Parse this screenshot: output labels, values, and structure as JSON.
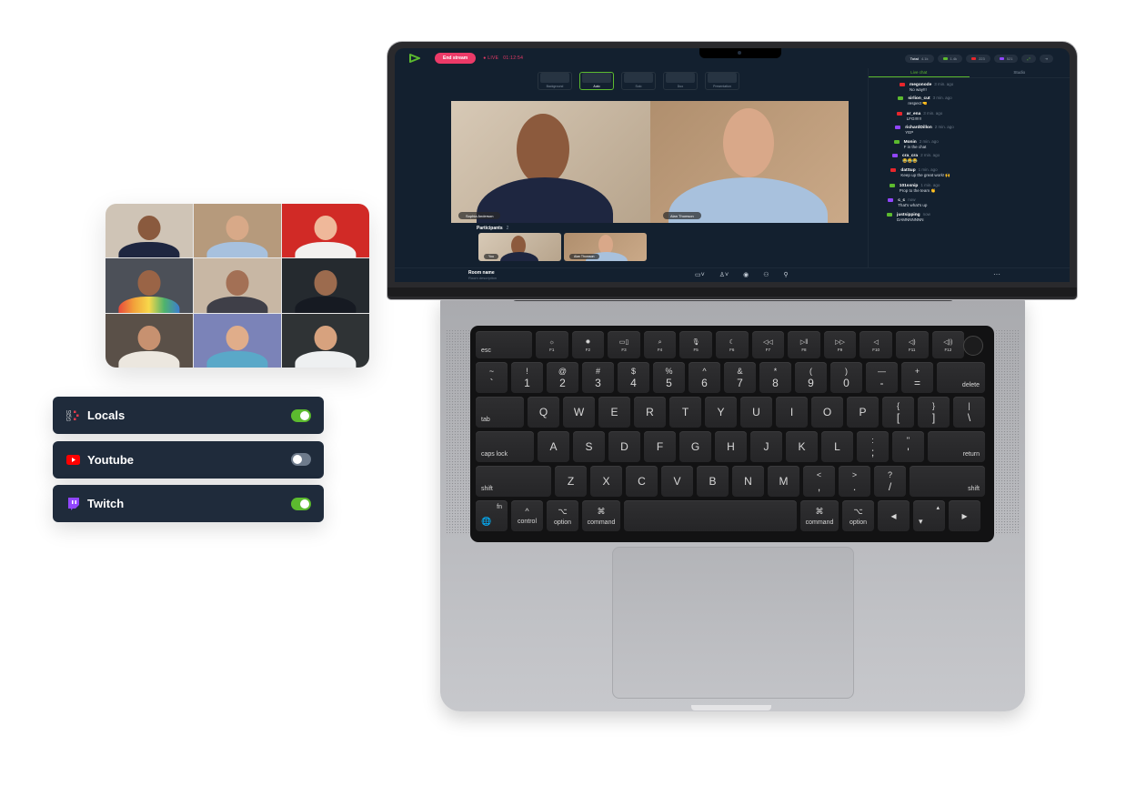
{
  "colors": {
    "accent_green": "#5cba2f",
    "live_red": "#ec3a68",
    "panel_dark": "#1f2b3b",
    "screen_bg": "#13202f",
    "youtube": "#ff0000",
    "twitch": "#9146ff",
    "locals": "#e33b4c"
  },
  "platforms": [
    {
      "name": "Locals",
      "icon": "locals-icon",
      "enabled": true
    },
    {
      "name": "Youtube",
      "icon": "youtube-icon",
      "enabled": false
    },
    {
      "name": "Twitch",
      "icon": "twitch-icon",
      "enabled": true
    }
  ],
  "app": {
    "end_stream_label": "End stream",
    "live_label": "● LIVE",
    "timer": "01:12:54",
    "stats": [
      {
        "label": "Total",
        "value": "4.1k",
        "icon": "total"
      },
      {
        "label": "",
        "value": "1.4k",
        "icon": "locals"
      },
      {
        "label": "",
        "value": "223",
        "icon": "youtube"
      },
      {
        "label": "",
        "value": "521",
        "icon": "twitch"
      }
    ],
    "layouts": [
      {
        "label": "Background",
        "active": false
      },
      {
        "label": "Auto",
        "active": true
      },
      {
        "label": "Solo",
        "active": false
      },
      {
        "label": "Duo",
        "active": false
      },
      {
        "label": "Presentation",
        "active": false
      }
    ],
    "stage": [
      {
        "name": "Sophia Anderson"
      },
      {
        "name": "Alan Thomson"
      }
    ],
    "participants_label": "Participants",
    "participants_count": "2",
    "participant_thumbs": [
      {
        "name": "You"
      },
      {
        "name": "Alan Thomson"
      }
    ],
    "room_name": "Room name",
    "room_description": "Room description",
    "tabs": [
      {
        "label": "Live chat",
        "active": true
      },
      {
        "label": "Studio",
        "active": false
      }
    ],
    "chat": [
      {
        "user": "megonode",
        "time": "3 min. ago",
        "text": "No way!!!",
        "platform": "youtube"
      },
      {
        "user": "sirlion_cut",
        "time": "3 min. ago",
        "text": "respect 🤜",
        "platform": "locals"
      },
      {
        "user": "ar_ena",
        "time": "3 min. ago",
        "text": "LFG!!!!!!",
        "platform": "youtube"
      },
      {
        "user": "richardDillon",
        "time": "2 min. ago",
        "text": "YEP",
        "platform": "twitch"
      },
      {
        "user": "Monin",
        "time": "2 min. ago",
        "text": "F in the chat",
        "platform": "locals"
      },
      {
        "user": "cra_cra",
        "time": "2 min. ago",
        "text": "😂😂😂",
        "platform": "twitch"
      },
      {
        "user": "datSup",
        "time": "1 min. ago",
        "text": "Keep up the great work! 🙌",
        "platform": "youtube"
      },
      {
        "user": "101ssnip",
        "time": "1 min. ago",
        "text": "Prop to the team 👏",
        "platform": "locals"
      },
      {
        "user": "c_c",
        "time": "now",
        "text": "That's what's up",
        "platform": "twitch"
      },
      {
        "user": "justsipping",
        "time": "now",
        "text": "DAMNNNNNN",
        "platform": "locals"
      }
    ]
  },
  "keyboard": {
    "row0": [
      {
        "b": "esc"
      },
      {
        "t": "☼",
        "b": "F1"
      },
      {
        "t": "✹",
        "b": "F2"
      },
      {
        "t": "▭▯",
        "b": "F3"
      },
      {
        "t": "⌕",
        "b": "F4"
      },
      {
        "t": "🎙",
        "b": "F5"
      },
      {
        "t": "☾",
        "b": "F6"
      },
      {
        "t": "◁◁",
        "b": "F7"
      },
      {
        "t": "▷‖",
        "b": "F8"
      },
      {
        "t": "▷▷",
        "b": "F9"
      },
      {
        "t": "◁",
        "b": "F10"
      },
      {
        "t": "◁)",
        "b": "F11"
      },
      {
        "t": "◁))",
        "b": "F12"
      }
    ],
    "row1": [
      {
        "t": "~",
        "b": "`"
      },
      {
        "t": "!",
        "b": "1"
      },
      {
        "t": "@",
        "b": "2"
      },
      {
        "t": "#",
        "b": "3"
      },
      {
        "t": "$",
        "b": "4"
      },
      {
        "t": "%",
        "b": "5"
      },
      {
        "t": "^",
        "b": "6"
      },
      {
        "t": "&",
        "b": "7"
      },
      {
        "t": "*",
        "b": "8"
      },
      {
        "t": "(",
        "b": "9"
      },
      {
        "t": ")",
        "b": "0"
      },
      {
        "t": "—",
        "b": "-"
      },
      {
        "t": "+",
        "b": "="
      },
      {
        "b": "delete"
      }
    ],
    "row2": [
      {
        "b": "tab"
      },
      {
        "b": "Q"
      },
      {
        "b": "W"
      },
      {
        "b": "E"
      },
      {
        "b": "R"
      },
      {
        "b": "T"
      },
      {
        "b": "Y"
      },
      {
        "b": "U"
      },
      {
        "b": "I"
      },
      {
        "b": "O"
      },
      {
        "b": "P"
      },
      {
        "t": "{",
        "b": "["
      },
      {
        "t": "}",
        "b": "]"
      },
      {
        "t": "|",
        "b": "\\"
      }
    ],
    "row3": [
      {
        "b": "caps lock"
      },
      {
        "b": "A"
      },
      {
        "b": "S"
      },
      {
        "b": "D"
      },
      {
        "b": "F"
      },
      {
        "b": "G"
      },
      {
        "b": "H"
      },
      {
        "b": "J"
      },
      {
        "b": "K"
      },
      {
        "b": "L"
      },
      {
        "t": ":",
        "b": ";"
      },
      {
        "t": "\"",
        "b": "'"
      },
      {
        "b": "return"
      }
    ],
    "row4": [
      {
        "b": "shift"
      },
      {
        "b": "Z"
      },
      {
        "b": "X"
      },
      {
        "b": "C"
      },
      {
        "b": "V"
      },
      {
        "b": "B"
      },
      {
        "b": "N"
      },
      {
        "b": "M"
      },
      {
        "t": "<",
        "b": ","
      },
      {
        "t": ">",
        "b": "."
      },
      {
        "t": "?",
        "b": "/"
      },
      {
        "b": "shift"
      }
    ],
    "row5": [
      {
        "t": "fn",
        "b": "🌐"
      },
      {
        "t": "^",
        "b": "control"
      },
      {
        "t": "⌥",
        "b": "option"
      },
      {
        "t": "⌘",
        "b": "command"
      },
      {
        "b": ""
      },
      {
        "t": "⌘",
        "b": "command"
      },
      {
        "t": "⌥",
        "b": "option"
      },
      {
        "b": "◂"
      },
      {
        "t": "▴",
        "b": "▾"
      },
      {
        "b": "▸"
      }
    ]
  }
}
